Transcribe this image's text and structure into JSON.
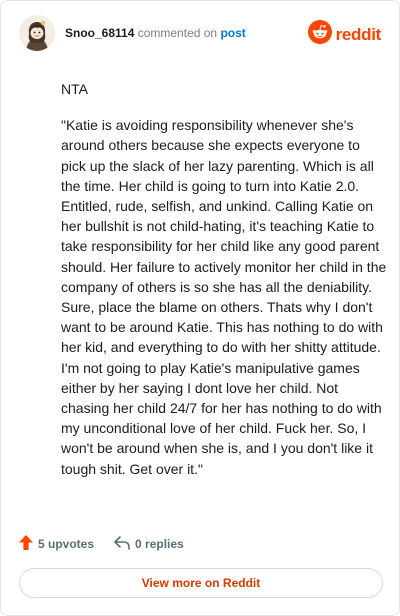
{
  "header": {
    "username": "Snoo_68114",
    "action_text": "commented on",
    "post_link": "post",
    "brand_text": "reddit",
    "avatar_icon": "snoo-avatar-icon",
    "brand_icon": "reddit-logo-icon",
    "brand_color": "#ff4500",
    "link_color": "#0079d3"
  },
  "comment": {
    "paragraphs": [
      "NTA",
      "\"Katie is avoiding responsibility whenever she's around others because she expects everyone to pick up the slack of her lazy parenting. Which is all the time. Her child is going to turn into Katie 2.0. Entitled, rude, selfish, and unkind. Calling Katie on her bullshit is not child-hating, it's teaching Katie to take responsibility for her child like any good parent should. Her failure to actively monitor her child in the company of others is so she has all the deniability. Sure, place the blame on others. Thats why I don't want to be around Katie. This has nothing to do with her kid, and everything to do with her shitty attitude. I'm not going to play Katie's manipulative games either by her saying I dont love her child. Not chasing her child 24/7 for her has nothing to do with my unconditional love of her child. Fuck her. So, I won't be around when she is, and I you don't like it tough shit. Get over it.\""
    ]
  },
  "footer": {
    "upvotes_label": "5 upvotes",
    "replies_label": "0 replies",
    "upvote_icon": "upvote-arrow-icon",
    "reply_icon": "reply-icon",
    "upvote_color": "#ff4500"
  },
  "view_more": {
    "label": "View more on Reddit",
    "color": "#d93a00"
  }
}
